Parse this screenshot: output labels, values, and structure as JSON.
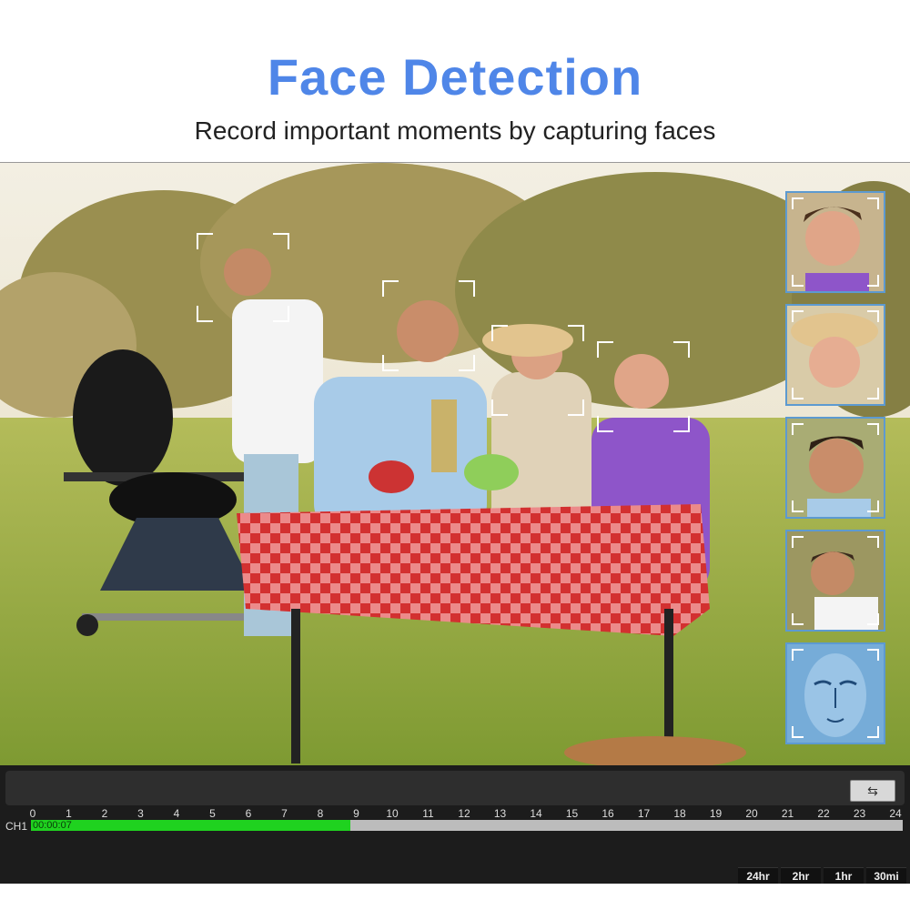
{
  "header": {
    "title": "Face Detection",
    "subtitle": "Record important moments by capturing faces"
  },
  "colors": {
    "title": "#4f86e8",
    "thumb_frame": "#5d9ad0",
    "record_green": "#1fd21f",
    "track_gray": "#bcbcbc",
    "timeline_bg": "#1c1c1c"
  },
  "thumbnails": [
    {
      "name": "boy-face"
    },
    {
      "name": "woman-face"
    },
    {
      "name": "man-face"
    },
    {
      "name": "griller-face"
    },
    {
      "name": "face-scan-icon"
    }
  ],
  "timeline": {
    "refresh_icon": "refresh-icon",
    "channel": "CH1",
    "timestamp": "00:00:07",
    "hours": [
      "0",
      "1",
      "2",
      "3",
      "4",
      "5",
      "6",
      "7",
      "8",
      "9",
      "10",
      "11",
      "12",
      "13",
      "14",
      "15",
      "16",
      "17",
      "18",
      "19",
      "20",
      "21",
      "22",
      "23",
      "24"
    ],
    "recorded_until_hour": 8.8,
    "zoom_options": [
      "24hr",
      "2hr",
      "1hr",
      "30mi"
    ]
  }
}
